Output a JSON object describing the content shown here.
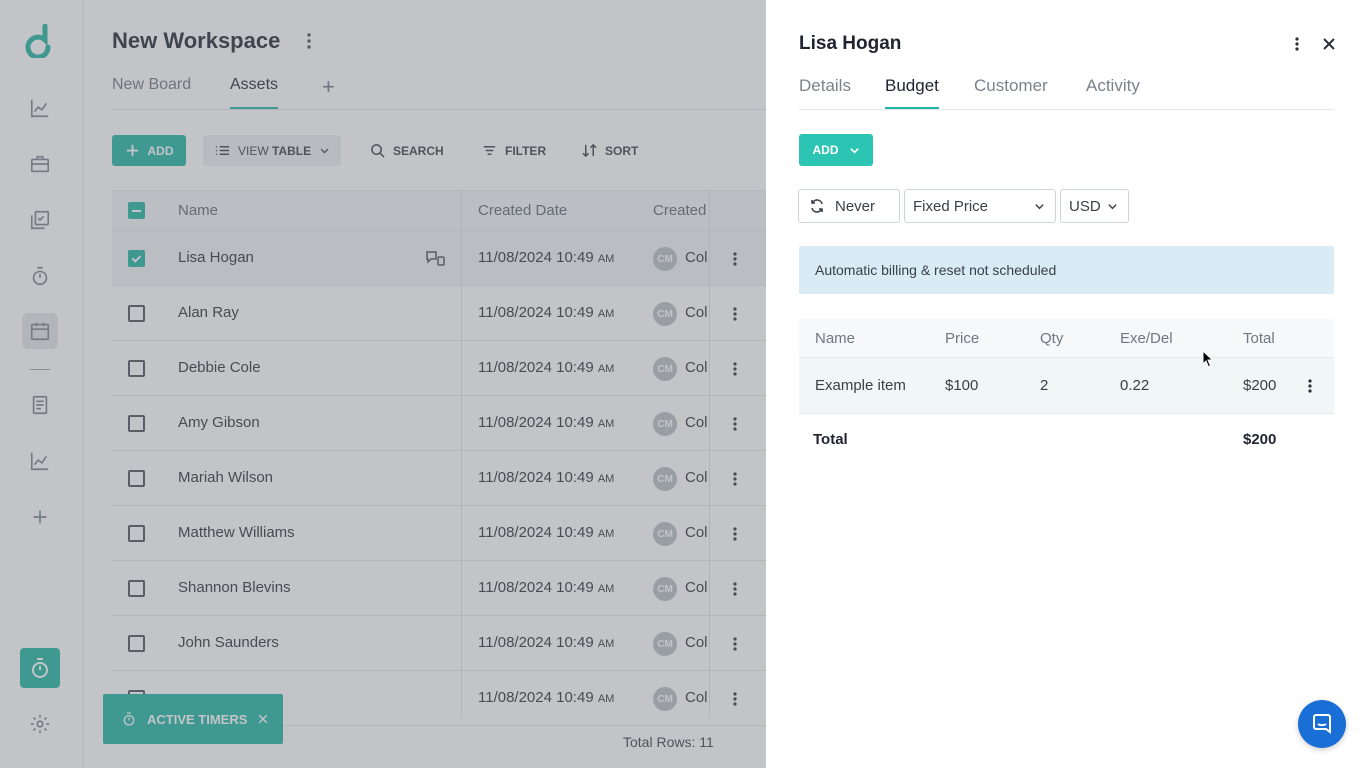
{
  "workspace": {
    "title": "New Workspace",
    "tabs": [
      "New Board",
      "Assets"
    ],
    "active_tab": "Assets"
  },
  "toolbar": {
    "add_label": "ADD",
    "view_label": "VIEW",
    "view_value": "TABLE",
    "search_label": "SEARCH",
    "filter_label": "FILTER",
    "sort_label": "SORT"
  },
  "grid": {
    "columns": [
      "Name",
      "Created Date",
      "Created"
    ],
    "rows": [
      {
        "name": "Lisa Hogan",
        "date": "11/08/2024 10:49",
        "ampm": "AM",
        "avatar": "CM",
        "creator": "Col",
        "checked": true
      },
      {
        "name": "Alan Ray",
        "date": "11/08/2024 10:49",
        "ampm": "AM",
        "avatar": "CM",
        "creator": "Col",
        "checked": false
      },
      {
        "name": "Debbie Cole",
        "date": "11/08/2024 10:49",
        "ampm": "AM",
        "avatar": "CM",
        "creator": "Col",
        "checked": false
      },
      {
        "name": "Amy Gibson",
        "date": "11/08/2024 10:49",
        "ampm": "AM",
        "avatar": "CM",
        "creator": "Col",
        "checked": false
      },
      {
        "name": "Mariah Wilson",
        "date": "11/08/2024 10:49",
        "ampm": "AM",
        "avatar": "CM",
        "creator": "Col",
        "checked": false
      },
      {
        "name": "Matthew Williams",
        "date": "11/08/2024 10:49",
        "ampm": "AM",
        "avatar": "CM",
        "creator": "Col",
        "checked": false
      },
      {
        "name": "Shannon Blevins",
        "date": "11/08/2024 10:49",
        "ampm": "AM",
        "avatar": "CM",
        "creator": "Col",
        "checked": false
      },
      {
        "name": "John Saunders",
        "date": "11/08/2024 10:49",
        "ampm": "AM",
        "avatar": "CM",
        "creator": "Col",
        "checked": false
      },
      {
        "name": "",
        "date": "11/08/2024 10:49",
        "ampm": "AM",
        "avatar": "CM",
        "creator": "Col",
        "checked": false
      }
    ],
    "total_rows": "Total Rows: 11"
  },
  "active_timers": "ACTIVE TIMERS",
  "panel": {
    "title": "Lisa Hogan",
    "tabs": [
      "Details",
      "Budget",
      "Customer",
      "Activity"
    ],
    "active_tab": "Budget",
    "add_label": "ADD",
    "recurrence": "Never",
    "pricing": "Fixed Price",
    "currency": "USD",
    "notice": "Automatic billing & reset not scheduled",
    "table": {
      "columns": [
        "Name",
        "Price",
        "Qty",
        "Exe/Del",
        "Total"
      ],
      "rows": [
        {
          "name": "Example item",
          "price": "$100",
          "qty": "2",
          "exe": "0.22",
          "total": "$200"
        }
      ],
      "total_label": "Total",
      "total_value": "$200"
    }
  },
  "colors": {
    "accent": "#1fb5a3",
    "notice_bg": "#d9ebf4",
    "chat": "#1a6fd6"
  }
}
